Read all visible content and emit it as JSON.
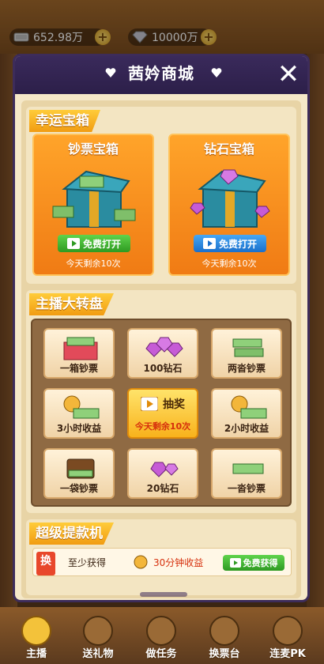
{
  "topbar": {
    "cash": {
      "icon": "cash-icon",
      "value": "652.98万"
    },
    "diamond": {
      "icon": "diamond-icon",
      "value": "10000万"
    },
    "plus_symbol": "+"
  },
  "modal": {
    "title": "茜妗商城",
    "close_symbol": "✕"
  },
  "lucky_box": {
    "tag": "幸运宝箱",
    "cards": [
      {
        "title": "钞票宝箱",
        "button": "免费打开",
        "button_color": "#2e9a22",
        "remain": "今天剩余10次"
      },
      {
        "title": "钻石宝箱",
        "button": "免费打开",
        "button_color": "#1a6fcb",
        "remain": "今天剩余10次"
      }
    ]
  },
  "wheel": {
    "tag": "主播大转盘",
    "cells": [
      {
        "label": "一箱钞票",
        "icon": "cash-box-icon"
      },
      {
        "label": "100钻石",
        "icon": "diamond-pile-icon"
      },
      {
        "label": "两沓钞票",
        "icon": "cash-stack-icon"
      },
      {
        "label": "3小时收益",
        "icon": "alarm-cash-icon"
      },
      {
        "label": "2小时收益",
        "icon": "alarm-cash-icon"
      },
      {
        "label": "一袋钞票",
        "icon": "cash-bag-icon"
      },
      {
        "label": "20钻石",
        "icon": "diamond-icon"
      },
      {
        "label": "一沓钞票",
        "icon": "cash-stack-icon"
      }
    ],
    "draw": {
      "label": "抽奖",
      "remain": "今天剩余10次"
    }
  },
  "withdraw": {
    "tag": "超级提款机",
    "badge": "换",
    "text": "至少获得",
    "reward": "30分钟收益",
    "button": "免费获得"
  },
  "bottom_nav": [
    {
      "label": "主播",
      "icon": "host-icon"
    },
    {
      "label": "送礼物",
      "icon": "gift-icon"
    },
    {
      "label": "做任务",
      "icon": "task-icon"
    },
    {
      "label": "换票台",
      "icon": "exchange-icon"
    },
    {
      "label": "连麦PK",
      "icon": "pk-icon"
    }
  ]
}
